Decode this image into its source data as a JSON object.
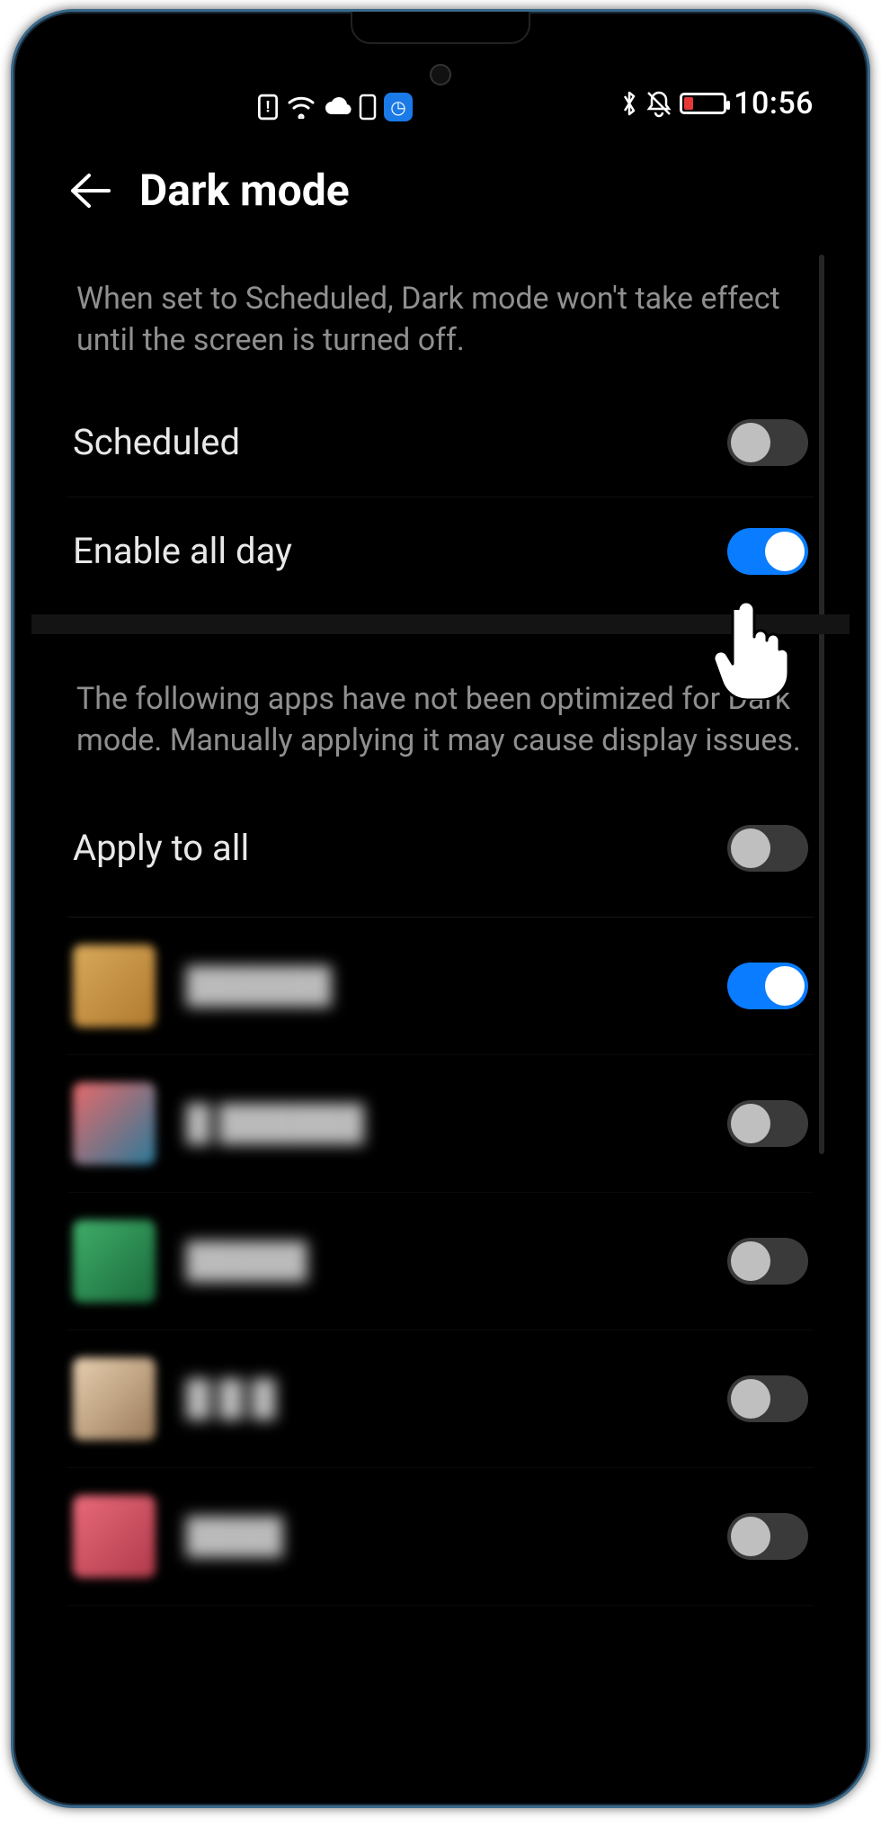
{
  "status": {
    "time": "10:56"
  },
  "header": {
    "title": "Dark mode"
  },
  "desc1": "When set to Scheduled, Dark mode won't take effect until the screen is turned off.",
  "settings": {
    "scheduled": {
      "label": "Scheduled",
      "on": false
    },
    "enable_all_day": {
      "label": "Enable all day",
      "on": true
    }
  },
  "desc2": "The following apps have not been optimized for Dark mode. Manually applying it may cause display issues.",
  "apply_all": {
    "label": "Apply to all",
    "on": false
  },
  "apps": [
    {
      "name": "██████",
      "on": true,
      "color1": "#d9a95a",
      "color2": "#b07a2e"
    },
    {
      "name": "█ ██████",
      "on": false,
      "color1": "#e86a6a",
      "color2": "#2a7a9a"
    },
    {
      "name": "█████",
      "on": false,
      "color1": "#3fae6a",
      "color2": "#1a6a3a"
    },
    {
      "name": "█ █ █",
      "on": false,
      "color1": "#e8d0b0",
      "color2": "#9a7a5a"
    },
    {
      "name": "████",
      "on": false,
      "color1": "#e86a7a",
      "color2": "#b03a4a"
    }
  ]
}
